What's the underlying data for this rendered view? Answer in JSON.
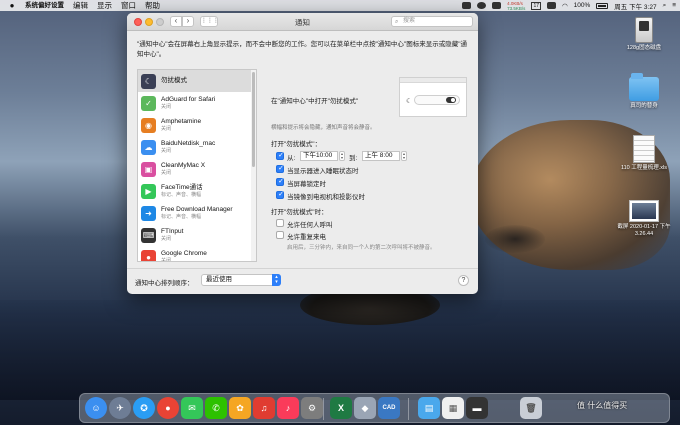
{
  "menubar": {
    "app_name": "系统偏好设置",
    "items": [
      "编辑",
      "显示",
      "窗口",
      "帮助"
    ],
    "net_up": "4.0KB/s",
    "net_down": "73.5KB/s",
    "calendar_day": "17",
    "battery": "100%",
    "clock": "周五 下午 3:27"
  },
  "desktop": {
    "icons": [
      {
        "name": "128g固态磁盘",
        "kind": "disk"
      },
      {
        "name": "真司的替身",
        "kind": "folder"
      },
      {
        "name": "110 工程量梳理.xls",
        "kind": "sheet"
      },
      {
        "name": "截屏 2020-01-17 下午 3.26.44",
        "kind": "screenshot"
      }
    ]
  },
  "window": {
    "title": "通知",
    "search_placeholder": "搜索",
    "description": "\"通知中心\"会在屏幕右上角显示提示，而不会中断您的工作。您可以在菜单栏中点按\"通知中心\"图标来显示或隐藏\"通知中心\"。",
    "apps": [
      {
        "name": "勿扰模式",
        "sub": "",
        "color": "#3a3f55",
        "glyph": "☾"
      },
      {
        "name": "AdGuard for Safari",
        "sub": "关闭",
        "color": "#5cb85c",
        "glyph": "✓"
      },
      {
        "name": "Amphetamine",
        "sub": "关闭",
        "color": "#e67e22",
        "glyph": "◉"
      },
      {
        "name": "BaiduNetdisk_mac",
        "sub": "关闭",
        "color": "#3b8ff0",
        "glyph": "☁"
      },
      {
        "name": "CleanMyMac X",
        "sub": "关闭",
        "color": "#d94fa0",
        "glyph": "▣"
      },
      {
        "name": "FaceTime通话",
        "sub": "标记、声音、横幅",
        "color": "#34c759",
        "glyph": "▶"
      },
      {
        "name": "Free Download Manager",
        "sub": "标记、声音、横幅",
        "color": "#1e88e5",
        "glyph": "➜"
      },
      {
        "name": "FTInput",
        "sub": "关闭",
        "color": "#333333",
        "glyph": "⌨"
      },
      {
        "name": "Google Chrome",
        "sub": "关闭",
        "color": "#e94335",
        "glyph": "●"
      }
    ],
    "detail": {
      "heading": "在\"通知中心\"中打开\"勿扰模式\"",
      "note": "横幅和提示将会隐藏，通知声音将会静音。",
      "turn_on_title": "打开\"勿扰模式\"：",
      "from_label": "从:",
      "from_time": "下午10:00",
      "to_label": "到:",
      "to_time": "上午 8:00",
      "options": [
        {
          "label": "当显示器进入睡眠状态时",
          "checked": true
        },
        {
          "label": "当屏幕锁定时",
          "checked": true
        },
        {
          "label": "当镜像到电视机和投影仪时",
          "checked": true
        }
      ],
      "while_on_title": "打开\"勿扰模式\"时：",
      "allow_calls": "允许任何人呼叫",
      "allow_repeat": "允许重复来电",
      "repeat_hint": "启用后，三分钟内，来自同一个人的第二次呼叫将不被静音。"
    },
    "sort_label": "通知中心排列顺序：",
    "sort_value": "最近使用",
    "help": "?"
  },
  "dock": {
    "apps": [
      {
        "name": "finder-icon",
        "color": "#3b8ff0",
        "glyph": "☺"
      },
      {
        "name": "launchpad-icon",
        "color": "#6e7d95",
        "glyph": "✈"
      },
      {
        "name": "safari-icon",
        "color": "#2a9df4",
        "glyph": "✪"
      },
      {
        "name": "chrome-icon",
        "color": "#e94335",
        "glyph": "●"
      },
      {
        "name": "messages-icon",
        "color": "#34c759",
        "glyph": "✉"
      },
      {
        "name": "wechat-icon",
        "color": "#2dc100",
        "glyph": "✆"
      },
      {
        "name": "photos-icon",
        "color": "#f5a623",
        "glyph": "✿"
      },
      {
        "name": "netease-music-icon",
        "color": "#e03c31",
        "glyph": "♫"
      },
      {
        "name": "music-icon",
        "color": "#fa3b5a",
        "glyph": "♪"
      },
      {
        "name": "system-preferences-icon",
        "color": "#7d7d7d",
        "glyph": "⚙"
      },
      {
        "name": "excel-icon",
        "color": "#1f7a43",
        "glyph": "X"
      },
      {
        "name": "utility-app-icon",
        "color": "#9aa5b5",
        "glyph": "◆"
      },
      {
        "name": "cad-icon",
        "color": "#3a78c3",
        "glyph": "CAD"
      },
      {
        "name": "downloads-folder-icon",
        "color": "#4aa8ec",
        "glyph": "▤"
      },
      {
        "name": "document-stack-icon",
        "color": "#f0f0f0",
        "glyph": "▦"
      },
      {
        "name": "screenshot-stack-icon",
        "color": "#333333",
        "glyph": "▬"
      },
      {
        "name": "trash-icon",
        "color": "#c9ced6",
        "glyph": "🗑"
      }
    ],
    "watermark": "值 什么值得买"
  }
}
